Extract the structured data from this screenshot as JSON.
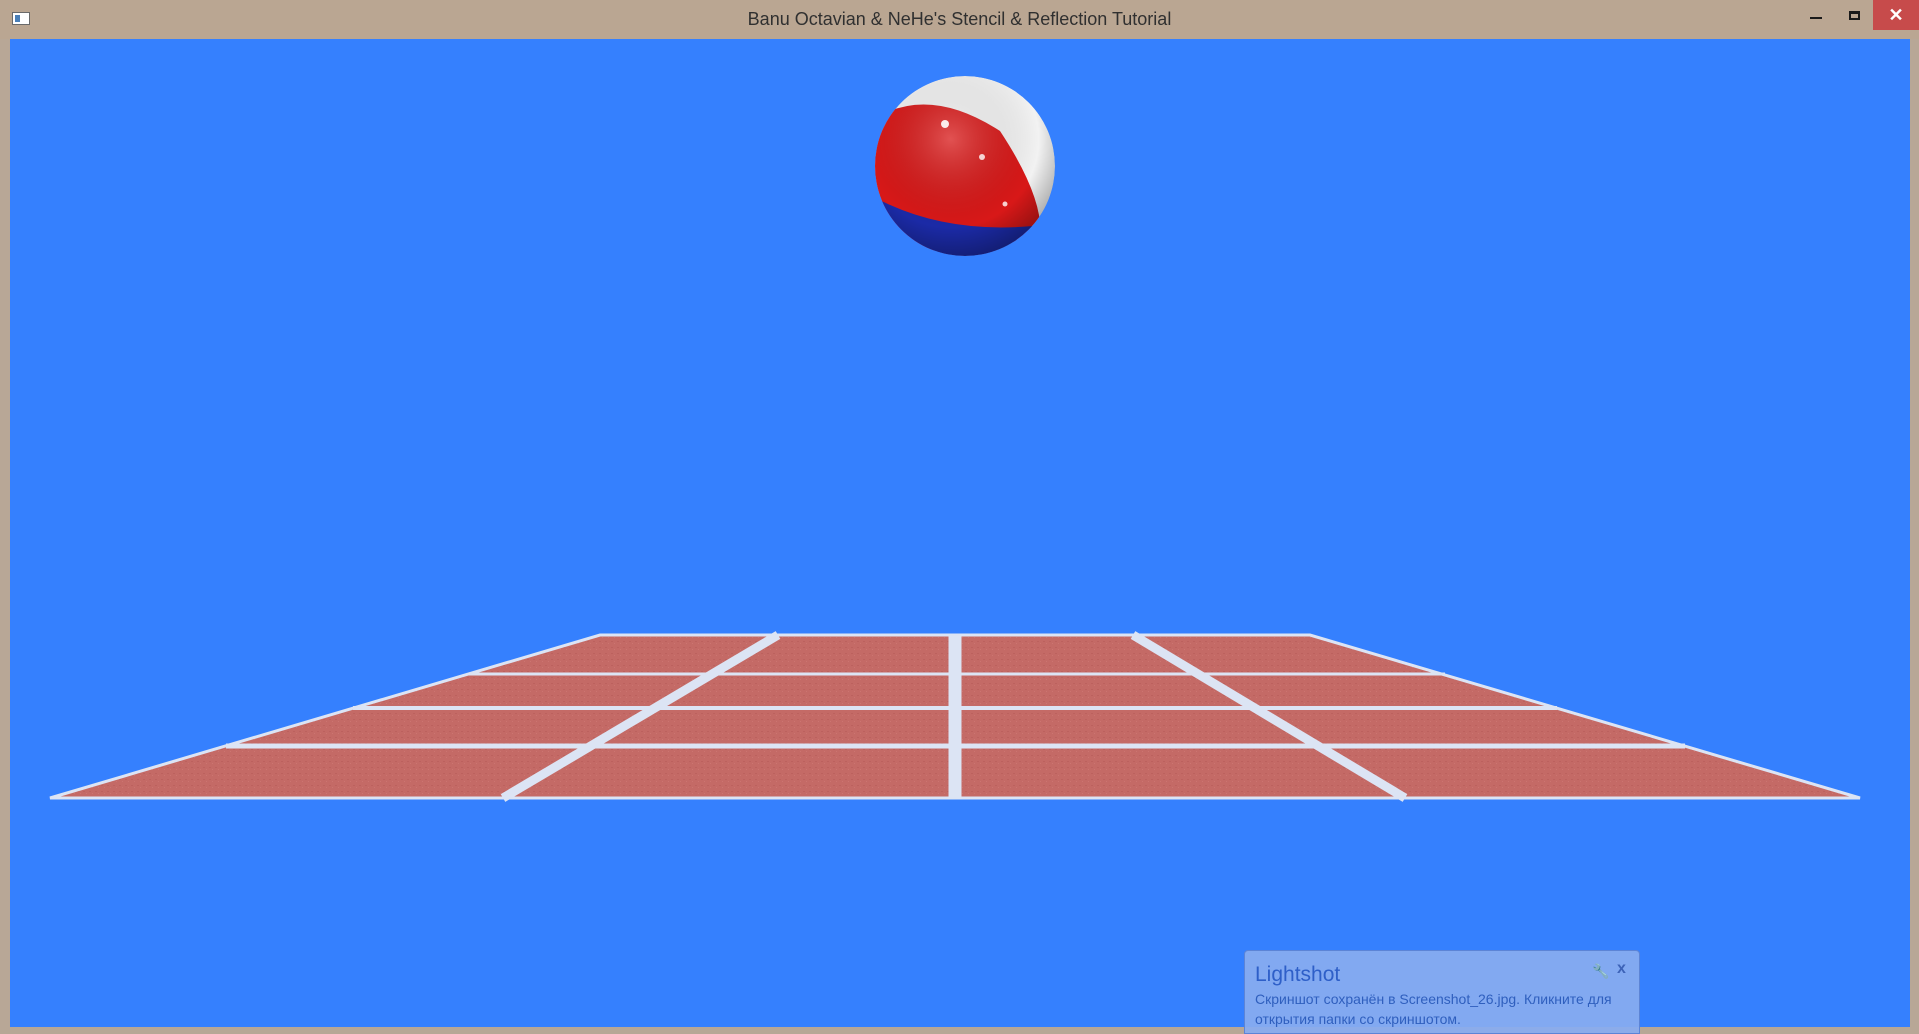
{
  "window": {
    "title": "Banu Octavian & NeHe's Stencil & Reflection Tutorial",
    "minimize_icon": "minimize-icon",
    "maximize_icon": "maximize-icon",
    "close_glyph": "✕"
  },
  "scene": {
    "background_color": "#3580fe",
    "floor_tile_color": "#c46a66",
    "floor_line_color": "#dce4f4",
    "ball_colors": [
      "#e01818",
      "#f4f4f4",
      "#1a2aa8"
    ]
  },
  "toast": {
    "title": "Lightshot",
    "body": "Скриншот сохранён в Screenshot_26.jpg. Кликните для открытия папки со скриншотом.",
    "settings_glyph": "🔧",
    "close_glyph": "x"
  }
}
